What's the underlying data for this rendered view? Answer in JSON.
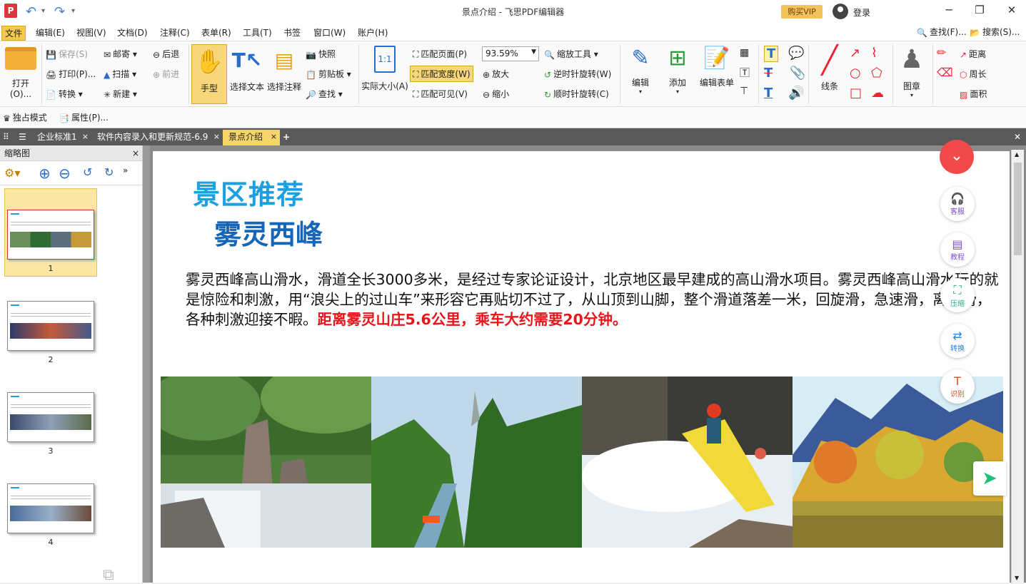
{
  "window": {
    "title": "景点介绍 - 飞思PDF编辑器",
    "app_icon": "P",
    "vip": "购买VIP",
    "login": "登录"
  },
  "menu": [
    "文件",
    "编辑(E)",
    "视图(V)",
    "文档(D)",
    "注释(C)",
    "表单(R)",
    "工具(T)",
    "书签",
    "窗口(W)",
    "账户(H)"
  ],
  "menu_right": {
    "find": "查找(F)...",
    "search": "搜索(S)..."
  },
  "ribbon": {
    "open": "打开(O)...",
    "save": "保存(S)",
    "print": "打印(P)...",
    "convert": "转换",
    "mail": "邮寄",
    "scan": "扫描",
    "new": "新建",
    "back": "后退",
    "forward": "前进",
    "hand": "手型",
    "select_text": "选择文本",
    "select_annot": "选择注释",
    "snapshot": "快照",
    "clipboard": "剪贴板",
    "find": "查找",
    "actual_size": "实际大小(A)",
    "fit_page": "匹配页面(P)",
    "fit_width": "匹配宽度(W)",
    "fit_visible": "匹配可见(V)",
    "zoom_value": "93.59%",
    "zoom_tool": "缩放工具",
    "zoom_in": "放大",
    "zoom_out": "缩小",
    "rotate_ccw": "逆时针旋转(W)",
    "rotate_cw": "顺时针旋转(C)",
    "edit": "编辑",
    "add": "添加",
    "edit_form": "编辑表单",
    "lines": "线条",
    "stamp": "图章",
    "distance": "距离",
    "perimeter": "周长",
    "area": "面积"
  },
  "toolbar2": {
    "exclusive": "独占模式",
    "properties": "属性(P)..."
  },
  "tabs": [
    {
      "label": "企业标准1",
      "active": false
    },
    {
      "label": "软件内容录入和更新规范-6.9",
      "active": false
    },
    {
      "label": "景点介绍",
      "active": true
    }
  ],
  "sidebar": {
    "title": "缩略图",
    "pages": [
      "1",
      "2",
      "3",
      "4"
    ]
  },
  "document": {
    "heading1": "景区推荐",
    "heading2": "雾灵西峰",
    "paragraph": "雾灵西峰高山滑水，滑道全长3000多米，是经过专家论证设计，北京地区最早建成的高山滑水项目。雾灵西峰高山滑水玩的就是惊险和刺激，用“浪尖上的过山车”来形容它再贴切不过了，从山顶到山脚，整个滑道落差一米，回旋滑，急速滑，离心滑，各种刺激迎接不暇。",
    "highlight": "距离雾灵山庄5.6公里，乘车大约需要20分钟。"
  },
  "side_actions": {
    "service": "客服",
    "tutorial": "教程",
    "compress": "压缩",
    "convert": "转换",
    "ocr": "识别"
  }
}
